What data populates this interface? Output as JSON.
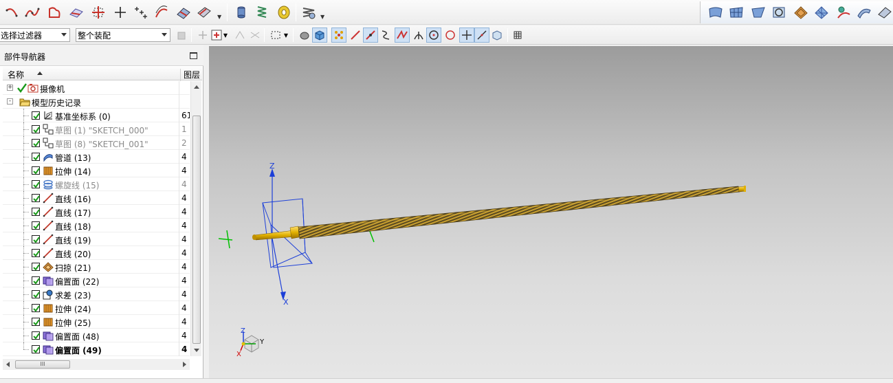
{
  "toolbar_row1": {
    "left_icons": [
      "arc-curve-icon",
      "spline-icon",
      "profile-icon",
      "studio-surface-icon",
      "trim-sketch-icon",
      "point-icon",
      "point-set-icon",
      "offset-curve-icon",
      "surface-icon",
      "sweep-icon",
      "cylinder-icon",
      "spring-icon",
      "roll-icon",
      "coil-icon"
    ],
    "right_icons": [
      "surface-patch-icon",
      "mesh-surface-icon",
      "ruled-surface-icon",
      "offset-surface-icon",
      "sweep-surface-icon",
      "grid-surface-icon",
      "analyze-icon",
      "law-surface-icon",
      "surface-extra-icon"
    ]
  },
  "toolbar_row2": {
    "selection_filter": "选择过滤器",
    "assembly_scope": "整个装配"
  },
  "navigator": {
    "title": "部件导航器",
    "col_name": "名称",
    "col_layer": "图层",
    "rows": [
      {
        "label": "摄像机",
        "layer": "",
        "icon": "camera-icon",
        "level": 0,
        "expander": "+",
        "check": "green",
        "dim": false,
        "bold": false
      },
      {
        "label": "模型历史记录",
        "layer": "",
        "icon": "folder-open-icon",
        "level": 0,
        "expander": "-",
        "check": "none",
        "dim": false,
        "bold": false
      },
      {
        "label": "基准坐标系 (0)",
        "layer": "61",
        "icon": "datum-csys-icon",
        "level": 1,
        "expander": "",
        "check": "box",
        "dim": false,
        "bold": false
      },
      {
        "label": "草图 (1) \"SKETCH_000\"",
        "layer": "1",
        "icon": "sketch-icon",
        "level": 1,
        "expander": "",
        "check": "box",
        "dim": true,
        "bold": false
      },
      {
        "label": "草图 (8) \"SKETCH_001\"",
        "layer": "2",
        "icon": "sketch-icon",
        "level": 1,
        "expander": "",
        "check": "box",
        "dim": true,
        "bold": false
      },
      {
        "label": "管道 (13)",
        "layer": "4",
        "icon": "tube-icon",
        "level": 1,
        "expander": "",
        "check": "box",
        "dim": false,
        "bold": false
      },
      {
        "label": "拉伸 (14)",
        "layer": "4",
        "icon": "extrude-icon",
        "level": 1,
        "expander": "",
        "check": "box",
        "dim": false,
        "bold": false
      },
      {
        "label": "螺旋线 (15)",
        "layer": "4",
        "icon": "helix-icon",
        "level": 1,
        "expander": "",
        "check": "box",
        "dim": true,
        "bold": false
      },
      {
        "label": "直线 (16)",
        "layer": "4",
        "icon": "line-icon",
        "level": 1,
        "expander": "",
        "check": "box",
        "dim": false,
        "bold": false
      },
      {
        "label": "直线 (17)",
        "layer": "4",
        "icon": "line-icon",
        "level": 1,
        "expander": "",
        "check": "box",
        "dim": false,
        "bold": false
      },
      {
        "label": "直线 (18)",
        "layer": "4",
        "icon": "line-icon",
        "level": 1,
        "expander": "",
        "check": "box",
        "dim": false,
        "bold": false
      },
      {
        "label": "直线 (19)",
        "layer": "4",
        "icon": "line-icon",
        "level": 1,
        "expander": "",
        "check": "box",
        "dim": false,
        "bold": false
      },
      {
        "label": "直线 (20)",
        "layer": "4",
        "icon": "line-icon",
        "level": 1,
        "expander": "",
        "check": "box",
        "dim": false,
        "bold": false
      },
      {
        "label": "扫掠 (21)",
        "layer": "4",
        "icon": "swept-icon",
        "level": 1,
        "expander": "",
        "check": "box",
        "dim": false,
        "bold": false
      },
      {
        "label": "偏置面 (22)",
        "layer": "4",
        "icon": "offset-face-icon",
        "level": 1,
        "expander": "",
        "check": "box",
        "dim": false,
        "bold": false
      },
      {
        "label": "求差 (23)",
        "layer": "4",
        "icon": "subtract-icon",
        "level": 1,
        "expander": "",
        "check": "box",
        "dim": false,
        "bold": false
      },
      {
        "label": "拉伸 (24)",
        "layer": "4",
        "icon": "extrude-icon",
        "level": 1,
        "expander": "",
        "check": "box",
        "dim": false,
        "bold": false
      },
      {
        "label": "拉伸 (25)",
        "layer": "4",
        "icon": "extrude-icon",
        "level": 1,
        "expander": "",
        "check": "box",
        "dim": false,
        "bold": false
      },
      {
        "label": "偏置面 (48)",
        "layer": "4",
        "icon": "offset-face-icon",
        "level": 1,
        "expander": "",
        "check": "box",
        "dim": false,
        "bold": false
      },
      {
        "label": "偏置面 (49)",
        "layer": "4",
        "icon": "offset-face-icon",
        "level": 1,
        "expander": "",
        "check": "box",
        "dim": false,
        "bold": true
      }
    ]
  },
  "viewport": {
    "axis_x": "X",
    "axis_y": "Y",
    "axis_z": "Z",
    "triad_x": "X",
    "triad_y": "Y",
    "triad_z": "Z",
    "colors": {
      "background_top": "#9c9c9c",
      "background_bottom": "#e6e6e6",
      "axis_blue": "#1c3fd8",
      "csys_green": "#00c000",
      "shaft_gold": "#e0b000",
      "spring_dark": "#5a4a20"
    }
  }
}
